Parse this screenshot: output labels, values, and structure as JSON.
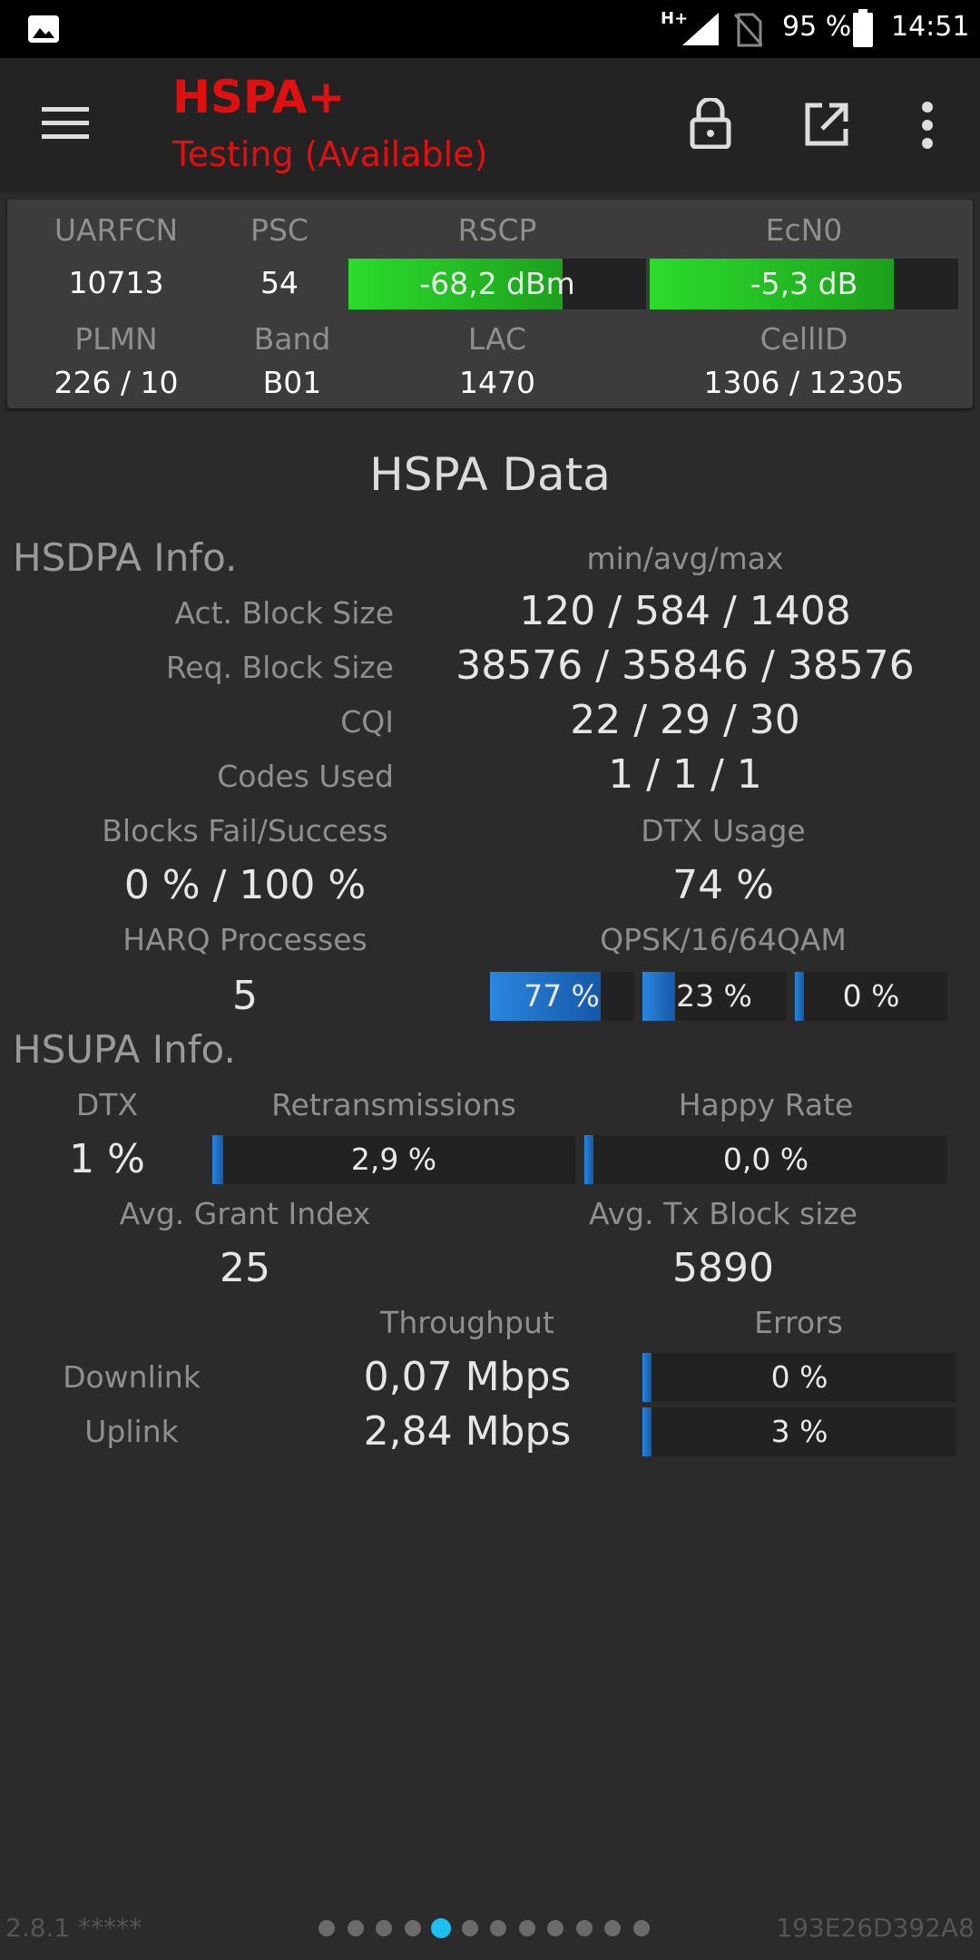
{
  "statusbar": {
    "network_type": "H+",
    "battery": "95 %",
    "time": "14:51"
  },
  "toolbar": {
    "title": "HSPA+",
    "subtitle": "Testing (Available)"
  },
  "cell": {
    "labels": {
      "uarfcn": "UARFCN",
      "psc": "PSC",
      "rscp": "RSCP",
      "ecn0": "EcN0",
      "plmn": "PLMN",
      "band": "Band",
      "lac": "LAC",
      "cellid": "CellID"
    },
    "uarfcn": "10713",
    "psc": "54",
    "rscp": "-68,2 dBm",
    "rscp_level": 0.72,
    "ecn0": "-5,3 dB",
    "ecn0_level": 0.79,
    "plmn": "226 / 10",
    "band": "B01",
    "lac": "1470",
    "cellid": "1306 / 12305"
  },
  "hspa": {
    "section_title": "HSPA Data",
    "hsdpa_title": "HSDPA Info.",
    "minavgmax_label": "min/avg/max",
    "act_block_label": "Act. Block Size",
    "act_block_value": "120 / 584 / 1408",
    "req_block_label": "Req. Block Size",
    "req_block_value": "38576 / 35846 / 38576",
    "cqi_label": "CQI",
    "cqi_value": "22 / 29 / 30",
    "codes_label": "Codes Used",
    "codes_value": "1 / 1 / 1",
    "blocks_label": "Blocks Fail/Success",
    "blocks_value": "0 % / 100 %",
    "dtx_usage_label": "DTX Usage",
    "dtx_usage_value": "74 %",
    "harq_label": "HARQ Processes",
    "harq_value": "5",
    "qam_label": "QPSK/16/64QAM",
    "qpsk": "77 %",
    "qpsk_level": 0.77,
    "qam16": "23 %",
    "qam16_level": 0.23,
    "qam64": "0 %",
    "qam64_level": 0.0,
    "hsupa_title": "HSUPA Info.",
    "dtx_label": "DTX",
    "dtx_value": "1 %",
    "retrans_label": "Retransmissions",
    "retrans_value": "2,9 %",
    "retrans_level": 0.029,
    "happy_label": "Happy Rate",
    "happy_value": "0,0 %",
    "happy_level": 0.0,
    "grant_label": "Avg. Grant Index",
    "grant_value": "25",
    "txblock_label": "Avg. Tx Block size",
    "txblock_value": "5890",
    "throughput_label": "Throughput",
    "errors_label": "Errors",
    "downlink_label": "Downlink",
    "downlink_value": "0,07 Mbps",
    "downlink_errors": "0 %",
    "downlink_errors_level": 0.0,
    "uplink_label": "Uplink",
    "uplink_value": "2,84 Mbps",
    "uplink_errors": "3 %",
    "uplink_errors_level": 0.03
  },
  "footer": {
    "version": "2.8.1 *****",
    "device_id": "193E26D392A8",
    "page_count": 12,
    "active_page": 4
  },
  "colors": {
    "title_red": "#e01010",
    "signal_green": "#2bdc2b",
    "bar_blue": "#2a86de",
    "active_dot": "#1ec0f0"
  },
  "icons": [
    "gallery-icon",
    "signal-icon",
    "no-sim-icon",
    "battery-icon",
    "menu-icon",
    "lock-icon",
    "open-external-icon",
    "overflow-menu-icon"
  ]
}
